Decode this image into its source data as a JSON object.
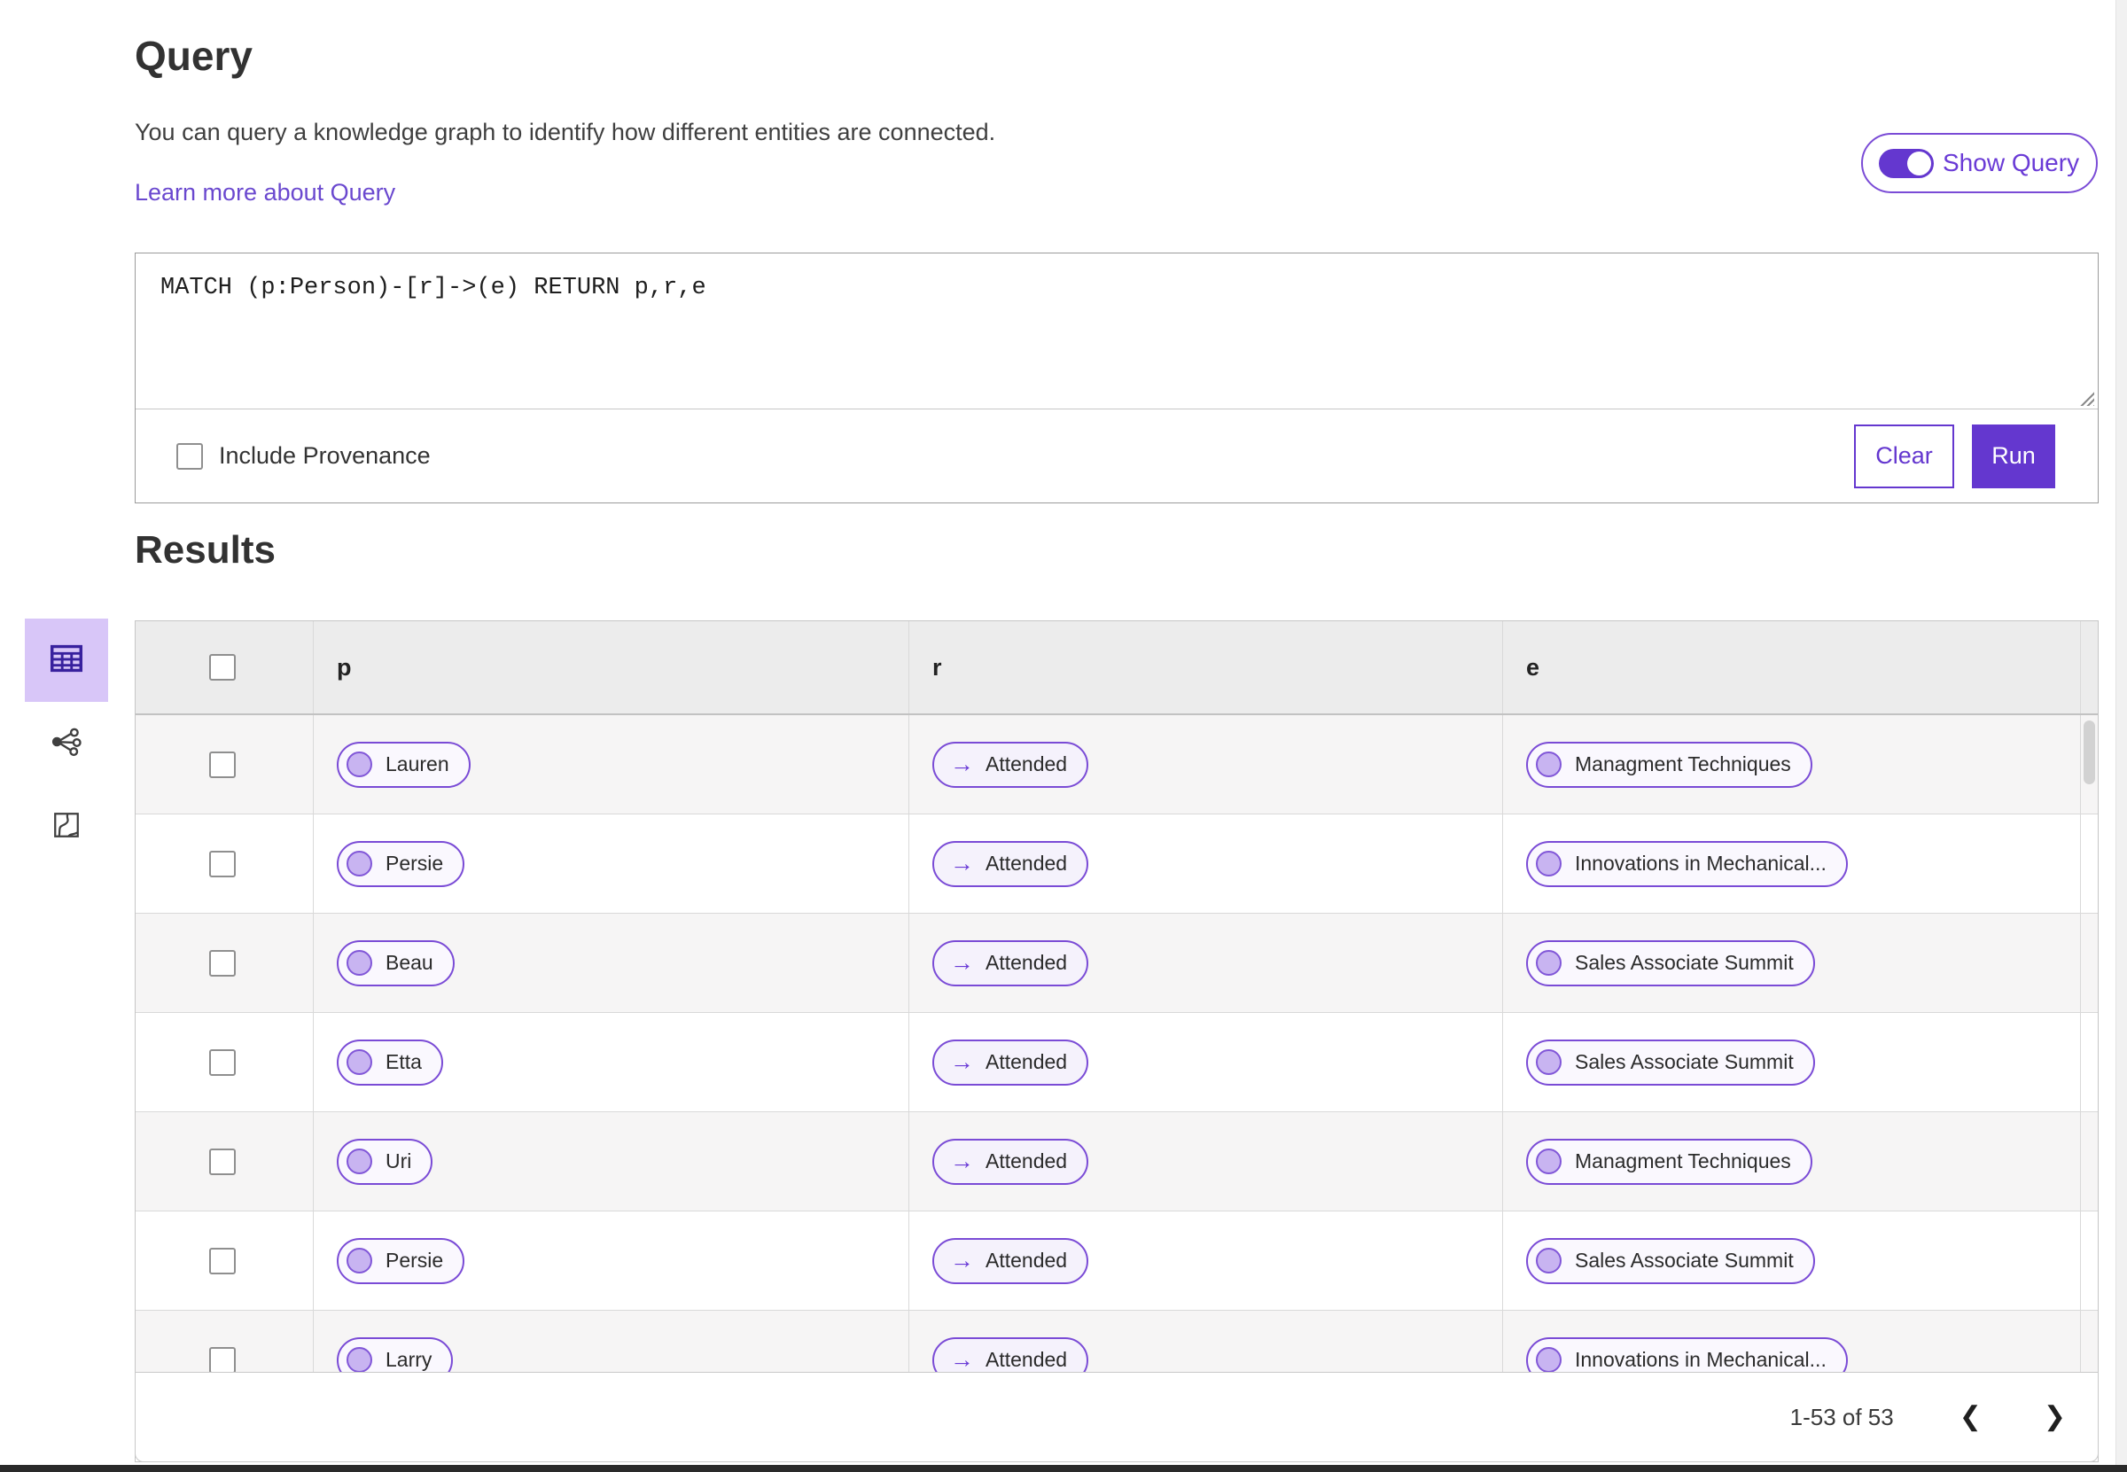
{
  "header": {
    "title": "Query",
    "description": "You can query a knowledge graph to identify how different entities are connected.",
    "learn_more_link": "Learn more about Query",
    "show_query_toggle": {
      "label": "Show Query",
      "state": "on"
    }
  },
  "query_editor": {
    "query_text": "MATCH (p:Person)-[r]->(e) RETURN p,r,e",
    "include_provenance": {
      "label": "Include Provenance",
      "checked": false
    },
    "buttons": {
      "clear": "Clear",
      "run": "Run"
    }
  },
  "results": {
    "heading": "Results",
    "view_switcher": {
      "selected": "table",
      "icons": [
        "table-view-icon",
        "graph-view-icon",
        "map-view-icon"
      ]
    },
    "table": {
      "columns": [
        "p",
        "r",
        "e"
      ],
      "relation_arrow": "→",
      "rows": [
        {
          "p": "Lauren",
          "r": "Attended",
          "e": "Managment Techniques"
        },
        {
          "p": "Persie",
          "r": "Attended",
          "e": "Innovations in Mechanical..."
        },
        {
          "p": "Beau",
          "r": "Attended",
          "e": "Sales Associate Summit"
        },
        {
          "p": "Etta",
          "r": "Attended",
          "e": "Sales Associate Summit"
        },
        {
          "p": "Uri",
          "r": "Attended",
          "e": "Managment Techniques"
        },
        {
          "p": "Persie",
          "r": "Attended",
          "e": "Sales Associate Summit"
        },
        {
          "p": "Larry",
          "r": "Attended",
          "e": "Innovations in Mechanical..."
        }
      ]
    },
    "pagination": {
      "range_label": "1-53 of 53",
      "prev_icon": "❮",
      "next_icon": "❯"
    }
  },
  "colors": {
    "accent": "#6437cf",
    "accent_light": "#d8c6f8",
    "pill_border": "#7a4bd6",
    "link": "#6a48cf"
  }
}
